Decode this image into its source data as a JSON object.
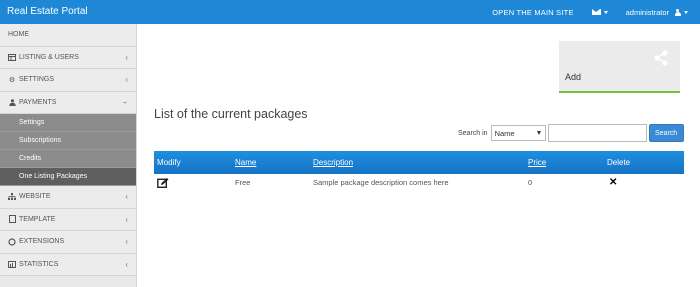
{
  "topbar": {
    "brand": "Real Estate Portal",
    "open_site": "OPEN THE MAIN SITE",
    "user": "administrator",
    "mail_icon": "envelope-icon",
    "user_icon": "user-icon"
  },
  "sidebar": {
    "home": "HOME",
    "items": [
      {
        "label": "LISTING & USERS",
        "icon": "table-icon"
      },
      {
        "label": "SETTINGS",
        "icon": "gears-icon"
      },
      {
        "label": "PAYMENTS",
        "icon": "user-icon"
      },
      {
        "label": "WEBSITE",
        "icon": "sitemap-icon"
      },
      {
        "label": "TEMPLATE",
        "icon": "file-icon"
      },
      {
        "label": "EXTENSIONS",
        "icon": "circle-icon"
      },
      {
        "label": "STATISTICS",
        "icon": "chart-icon"
      }
    ],
    "payments_sub": [
      "Settings",
      "Subscriptions",
      "Credits",
      "One Listing Packages"
    ]
  },
  "add_card": {
    "label": "Add",
    "icon": "share-icon"
  },
  "page_title": "List of the current packages",
  "search": {
    "label": "Search in",
    "field": "Name",
    "button": "Search",
    "value": ""
  },
  "table": {
    "headers": [
      "Modify",
      "Name",
      "Description",
      "Price",
      "Delete"
    ],
    "rows": [
      {
        "name": "Free",
        "description": "Sample package description comes here",
        "price": "0"
      }
    ]
  },
  "colors": {
    "topbar": "#1e88d6",
    "accent_green": "#7cbf3a",
    "table_header": "#1a7fd2"
  }
}
